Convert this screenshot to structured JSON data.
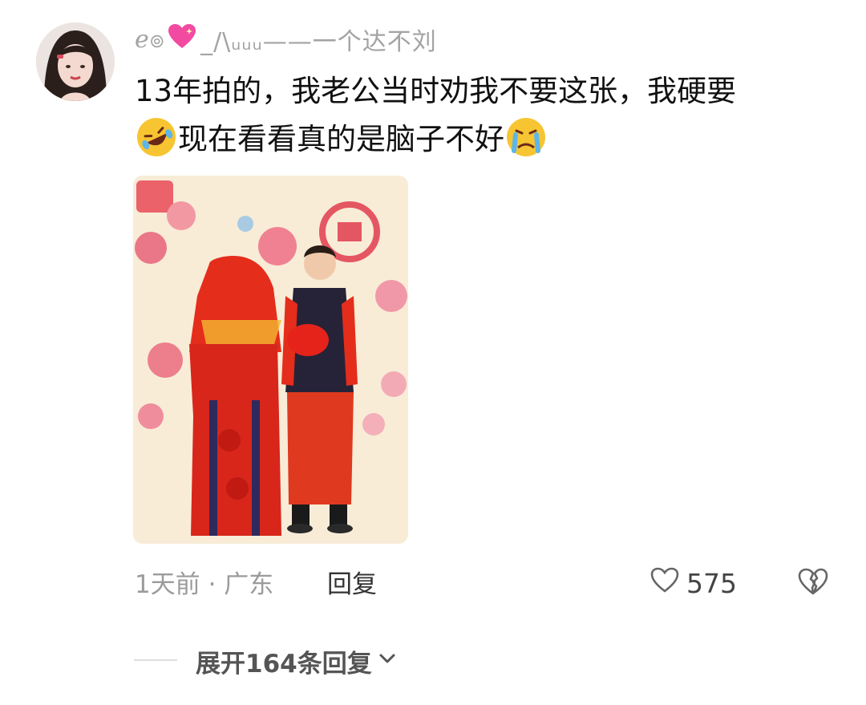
{
  "comment": {
    "username_prefix": "ℯ๏",
    "username_icon": "sparkling-heart-icon",
    "username_suffix": "_/\\ᵤᵤᵤ——一个达不刘",
    "text_line1": "13年拍的，我老公当时劝我不要这张，我硬要",
    "text_line2": "现在看看真的是脑子不好",
    "emoji_1": "rolling-on-floor-laughing-emoji",
    "emoji_2": "crying-face-emoji",
    "photo_icon": "wedding-photo",
    "meta": "1天前 · 广东",
    "reply_label": "回复",
    "like_count": "575"
  },
  "replies": {
    "expand_label": "展开164条回复"
  },
  "colors": {
    "accent_red": "#d9261c",
    "meta_gray": "#9b9b9b",
    "text": "#111111"
  }
}
